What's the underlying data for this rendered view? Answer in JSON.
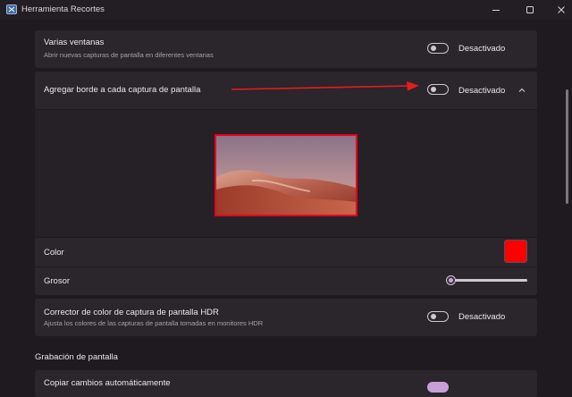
{
  "window": {
    "title": "Herramienta Recortes",
    "controls": [
      "minimize-icon",
      "maximize-icon",
      "close-icon"
    ]
  },
  "settings": {
    "multiple_windows": {
      "label": "Varias ventanas",
      "description": "Abrir nuevas capturas de pantalla en diferentes ventanas",
      "toggle_state": "Desactivado",
      "enabled": false
    },
    "add_border": {
      "label": "Agregar borde a cada captura de pantalla",
      "toggle_state": "Desactivado",
      "enabled": false,
      "expanded": true,
      "color_label": "Color",
      "color_value": "#fd0000",
      "thickness_label": "Grosor",
      "thickness_level": 0.05
    },
    "hdr_corrector": {
      "label": "Corrector de color de captura de pantalla HDR",
      "description": "Ajusta los colores de las capturas de pantalla tomadas en monitores HDR",
      "toggle_state": "Desactivado",
      "enabled": false
    },
    "screen_recording_section": "Grabación de pantalla",
    "copy_changes": {
      "label": "Copiar cambios automáticamente"
    }
  },
  "colors": {
    "background": "#1e1a1f",
    "card": "#2b252c",
    "annotation_arrow": "#e81c1c",
    "preview_border": "#e8001c"
  }
}
